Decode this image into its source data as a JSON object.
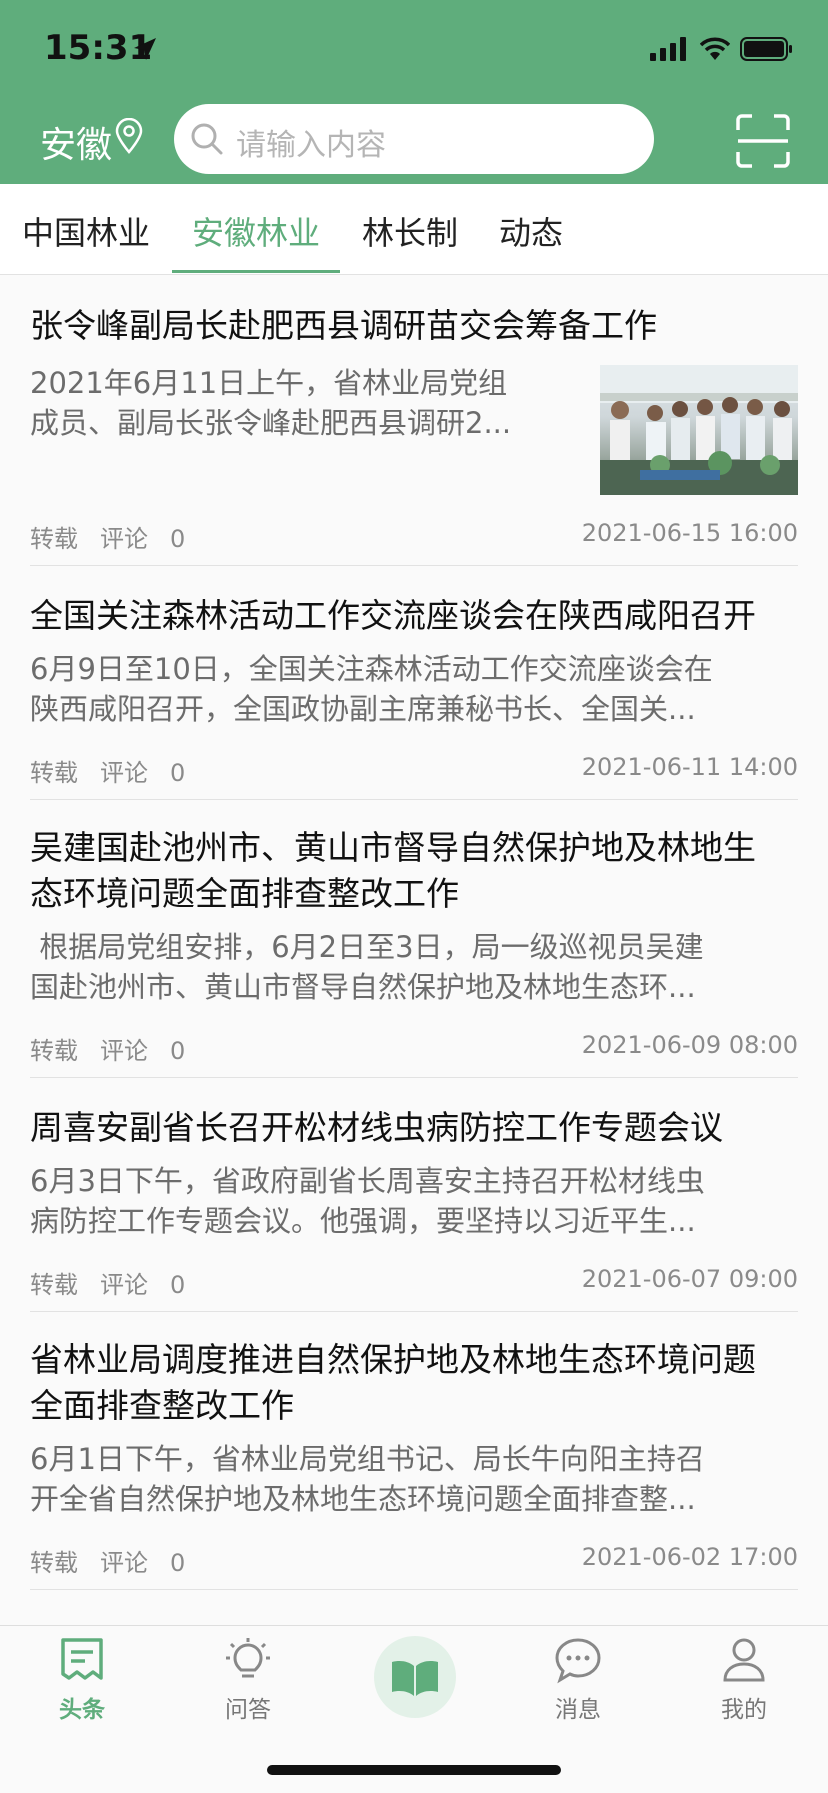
{
  "status_bar": {
    "time": "15:31"
  },
  "header": {
    "city": "安徽",
    "search_placeholder": "请输入内容"
  },
  "tabs": [
    {
      "label": "中国林业",
      "active": false
    },
    {
      "label": "安徽林业",
      "active": true
    },
    {
      "label": "林长制",
      "active": false
    },
    {
      "label": "动态",
      "active": false
    }
  ],
  "articles": [
    {
      "title": "张令峰副局长赴肥西县调研苗交会筹备工作",
      "summary_lines": [
        "2021年6月11日上午，省林业局党组",
        "成员、副局长张令峰赴肥西县调研2..."
      ],
      "repost": "转载",
      "comment_label": "评论",
      "comment_count": "0",
      "date": "2021-06-15 16:00",
      "has_image": true
    },
    {
      "title": "全国关注森林活动工作交流座谈会在陕西咸阳召开",
      "summary_lines": [
        "6月9日至10日，全国关注森林活动工作交流座谈会在",
        "陕西咸阳召开，全国政协副主席兼秘书长、全国关..."
      ],
      "repost": "转载",
      "comment_label": "评论",
      "comment_count": "0",
      "date": "2021-06-11 14:00"
    },
    {
      "title_lines": [
        "吴建国赴池州市、黄山市督导自然保护地及林地生",
        "态环境问题全面排查整改工作"
      ],
      "summary_lines": [
        " 根据局党组安排，6月2日至3日，局一级巡视员吴建",
        "国赴池州市、黄山市督导自然保护地及林地生态环..."
      ],
      "repost": "转载",
      "comment_label": "评论",
      "comment_count": "0",
      "date": "2021-06-09 08:00"
    },
    {
      "title": "周喜安副省长召开松材线虫病防控工作专题会议",
      "summary_lines": [
        "6月3日下午，省政府副省长周喜安主持召开松材线虫",
        "病防控工作专题会议。他强调，要坚持以习近平生..."
      ],
      "repost": "转载",
      "comment_label": "评论",
      "comment_count": "0",
      "date": "2021-06-07 09:00"
    },
    {
      "title_lines": [
        "省林业局调度推进自然保护地及林地生态环境问题",
        "全面排查整改工作"
      ],
      "summary_lines": [
        "6月1日下午，省林业局党组书记、局长牛向阳主持召",
        "开全省自然保护地及林地生态环境问题全面排查整..."
      ],
      "repost": "转载",
      "comment_label": "评论",
      "comment_count": "0",
      "date": "2021-06-02 17:00"
    }
  ],
  "bottom_nav": [
    {
      "label": "头条",
      "icon": "headlines-icon",
      "active": true
    },
    {
      "label": "问答",
      "icon": "lightbulb-icon",
      "active": false
    },
    {
      "label": "",
      "icon": "book-icon",
      "active": false
    },
    {
      "label": "消息",
      "icon": "chat-icon",
      "active": false
    },
    {
      "label": "我的",
      "icon": "user-icon",
      "active": false
    }
  ],
  "colors": {
    "brand_green": "#5fad7c",
    "header_bg": "#5fad7c"
  }
}
